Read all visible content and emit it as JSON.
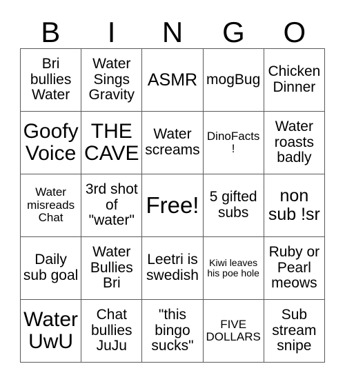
{
  "card": {
    "header": {
      "letters": [
        "B",
        "I",
        "N",
        "G",
        "O"
      ]
    },
    "rows": [
      [
        {
          "text": "Bri bullies Water",
          "size": "fs-md"
        },
        {
          "text": "Water Sings Gravity",
          "size": "fs-md"
        },
        {
          "text": "ASMR",
          "size": "fs-lg"
        },
        {
          "text": "mogBug",
          "size": "fs-md"
        },
        {
          "text": "Chicken Dinner",
          "size": "fs-md"
        }
      ],
      [
        {
          "text": "Goofy Voice",
          "size": "fs-xl"
        },
        {
          "text": "THE CAVE",
          "size": "fs-xl"
        },
        {
          "text": "Water screams",
          "size": "fs-md"
        },
        {
          "text": "DinoFacts!",
          "size": "fs-sm"
        },
        {
          "text": "Water roasts badly",
          "size": "fs-md"
        }
      ],
      [
        {
          "text": "Water misreads Chat",
          "size": "fs-sm"
        },
        {
          "text": "3rd shot of \"water\"",
          "size": "fs-md"
        },
        {
          "text": "Free!",
          "size": "fs-xxl"
        },
        {
          "text": "5 gifted subs",
          "size": "fs-md"
        },
        {
          "text": "non sub !sr",
          "size": "fs-lg"
        }
      ],
      [
        {
          "text": "Daily sub goal",
          "size": "fs-md"
        },
        {
          "text": "Water Bullies Bri",
          "size": "fs-md"
        },
        {
          "text": "Leetri is swedish",
          "size": "fs-md"
        },
        {
          "text": "Kiwi leaves his poe hole",
          "size": "fs-xs"
        },
        {
          "text": "Ruby or Pearl meows",
          "size": "fs-md"
        }
      ],
      [
        {
          "text": "Water UwU",
          "size": "fs-xl"
        },
        {
          "text": "Chat bullies JuJu",
          "size": "fs-md"
        },
        {
          "text": "\"this bingo sucks\"",
          "size": "fs-md"
        },
        {
          "text": "FIVE DOLLARS",
          "size": "fs-sm"
        },
        {
          "text": "Sub stream snipe",
          "size": "fs-md"
        }
      ]
    ]
  },
  "colors": {
    "background": "#ffffff",
    "text": "#000000",
    "grid_line": "#595959"
  }
}
